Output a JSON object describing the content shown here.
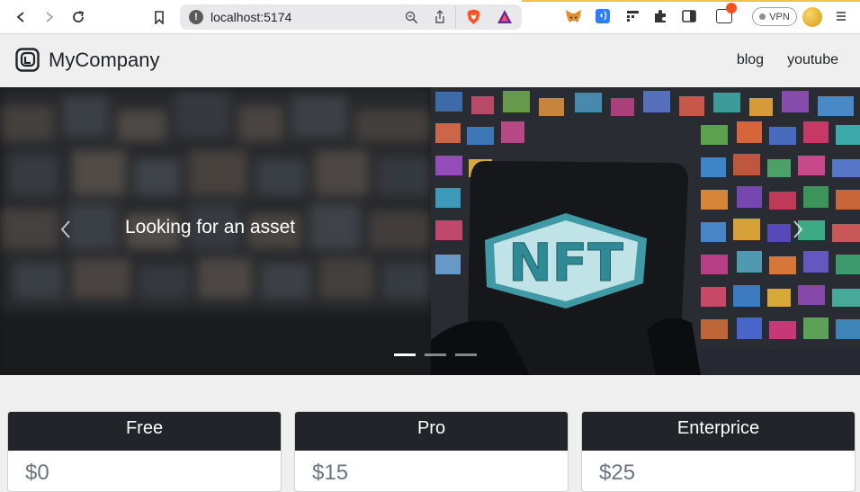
{
  "browser": {
    "url": "localhost:5174",
    "vpn_label": "VPN"
  },
  "navbar": {
    "brand": "MyCompany",
    "links": [
      "blog",
      "youtube"
    ]
  },
  "carousel": {
    "caption": "Looking for an asset",
    "slide_count": 3,
    "active_index": 0,
    "image_text": "NFT"
  },
  "pricing": {
    "plans": [
      {
        "name": "Free",
        "price": "$0"
      },
      {
        "name": "Pro",
        "price": "$15"
      },
      {
        "name": "Enterprice",
        "price": "$25"
      }
    ]
  },
  "colors": {
    "card_header": "#212529",
    "nft_teal": "#5fb3bd"
  }
}
